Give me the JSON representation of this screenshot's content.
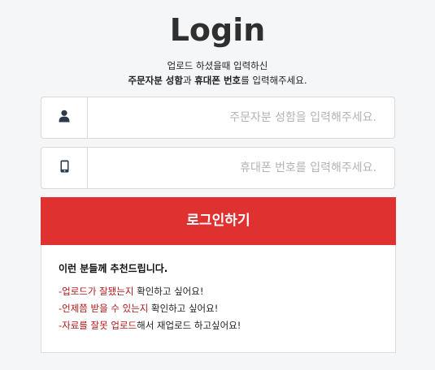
{
  "page": {
    "title": "Login",
    "subtitle_line1": "업로드 하셨을때 입력하신",
    "subtitle_line2_part1": "주문자분 성함",
    "subtitle_line2_part2": "과 ",
    "subtitle_line2_part3": "휴대폰 번호",
    "subtitle_line2_part4": "를 입력해주세요."
  },
  "form": {
    "name_placeholder": "주문자분 성함을 입력해주세요.",
    "name_value": "",
    "phone_placeholder": "휴대폰 번호를 입력해주세요.",
    "phone_value": "",
    "name_icon": "user-icon",
    "phone_icon": "mobile-phone-icon",
    "login_label": "로그인하기"
  },
  "notice": {
    "title": "이런 분들께 추천드립니다.",
    "items": [
      {
        "highlight": "-업로드가 잘됐는지",
        "rest": " 확인하고 싶어요!"
      },
      {
        "highlight": "-언제쯤 받을 수 있는지",
        "rest": " 확인하고 싶어요!"
      },
      {
        "highlight": "-자료를 잘못 업로드",
        "rest": "해서 재업로드 하고싶어요!"
      }
    ]
  },
  "colors": {
    "accent": "#e03131",
    "highlight_text": "#b01818",
    "background": "#f5f6f8"
  }
}
